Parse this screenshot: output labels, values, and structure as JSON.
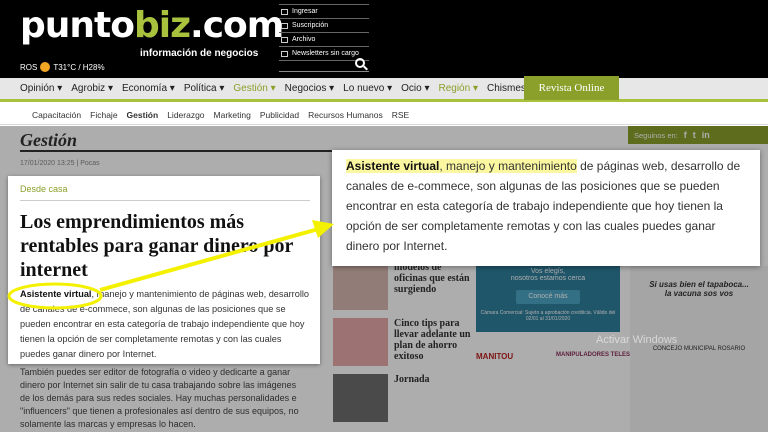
{
  "site": {
    "logo_part1": "punto",
    "logo_part2": "biz",
    "logo_part3": ".com",
    "tagline": "información de negocios",
    "weather": {
      "city": "ROS",
      "temp": "T31°C / H28%"
    }
  },
  "utility_links": [
    "Ingresar",
    "Suscripción",
    "Archivo",
    "Newsletters sin cargo"
  ],
  "nav": {
    "items": [
      {
        "label": "Opinión ▾"
      },
      {
        "label": "Agrobiz ▾"
      },
      {
        "label": "Economía ▾"
      },
      {
        "label": "Política ▾"
      },
      {
        "label": "Gestión ▾"
      },
      {
        "label": "Negocios ▾"
      },
      {
        "label": "Lo nuevo ▾"
      },
      {
        "label": "Ocio ▾"
      },
      {
        "label": "Región ▾"
      },
      {
        "label": "Chismes ▾"
      }
    ],
    "revista": "Revista Online"
  },
  "subnav": [
    "Capacitación",
    "Fichaje",
    "Gestión",
    "Liderazgo",
    "Marketing",
    "Publicidad",
    "Recursos Humanos",
    "RSE"
  ],
  "section": {
    "title": "Gestión",
    "date": "17/01/2020 13:25 | Pocas"
  },
  "social": {
    "label": "Seguinos en:",
    "icons": [
      "f",
      "t",
      "in"
    ]
  },
  "article": {
    "category": "Desde casa",
    "title": "Los emprendimientos más rentables para ganar dinero por internet",
    "lead_highlight": "Asistente virtual",
    "lead_rest": ", manejo y mantenimiento de páginas web, desarrollo de canales de e-commece, son algunas de las posiciones que se pueden encontrar en esta categoría de trabajo independiente que hoy tienen la opción de ser completamente remotas y con las cuales puedes ganar dinero por Internet.",
    "bg_paragraph": "También puedes ser editor de fotografía o video y dedicarte a ganar dinero por Internet sin salir de tu casa trabajando sobre las imágenes de los demás para sus redes sociales. Hay muchas personalidades e \"influencers\" que tienen a profesionales así dentro de sus equipos, no solamente las marcas y empresas lo hacen."
  },
  "zoom": {
    "highlight_bold": "Asistente virtual",
    "highlight_rest": ", manejo y mantenimiento",
    "rest": " de páginas web, desarrollo de canales de e-commece, son algunas de las posiciones que se pueden encontrar en esta categoría de trabajo independiente que hoy tienen la opción de ser completamente remotas y con las cuales puedes ganar dinero por Internet."
  },
  "related": [
    {
      "title": "modelos de oficinas que están surgiendo"
    },
    {
      "title": "Cinco tips para llevar adelante un plan de ahorro exitoso"
    },
    {
      "title": "Jornada"
    }
  ],
  "promo": {
    "line1": "Vos elegís,",
    "line2": "nosotros estamos cerca",
    "button": "Conocé más",
    "foot": "Cámara Comercial: Sujeto a aprobación crediticia. Válido del 02/01 al 31/01/2020"
  },
  "brands": {
    "a": "MANITOU",
    "b": "MANIPULADORES TELESCÓPICOS"
  },
  "ad_right": {
    "line1": "Si usas bien el tapaboca...",
    "line2": "la vacuna sos vos",
    "line3": "CONCEJO MUNICIPAL ROSARIO"
  },
  "watermark": "Activar Windows",
  "colors": {
    "brand_green": "#8aa02b",
    "highlight": "#fbf7a0",
    "annotation": "#f4f100"
  }
}
